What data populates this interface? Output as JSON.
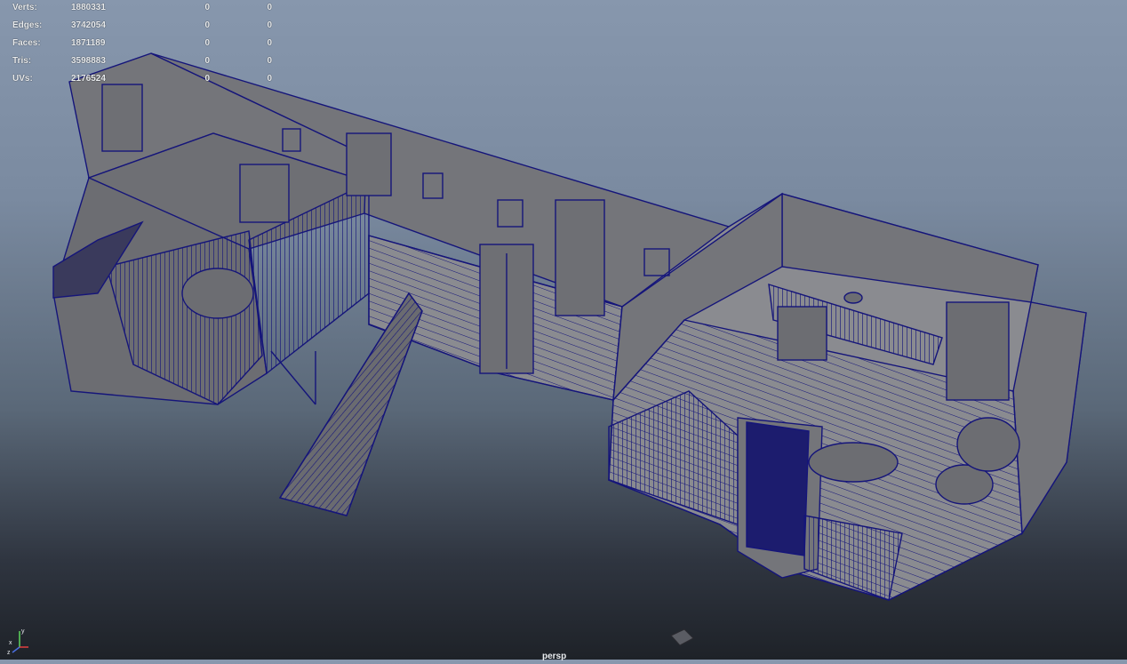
{
  "hud": {
    "rows": [
      {
        "label": "Verts:",
        "total": "1880331",
        "selected": "0",
        "component": "0"
      },
      {
        "label": "Edges:",
        "total": "3742054",
        "selected": "0",
        "component": "0"
      },
      {
        "label": "Faces:",
        "total": "1871189",
        "selected": "0",
        "component": "0"
      },
      {
        "label": "Tris:",
        "total": "3598883",
        "selected": "0",
        "component": "0"
      },
      {
        "label": "UVs:",
        "total": "2176524",
        "selected": "0",
        "component": "0"
      }
    ]
  },
  "camera": {
    "name": "persp"
  },
  "axis_gizmo": {
    "x": "x",
    "y": "y",
    "z": "z"
  },
  "colors": {
    "wire": "#15157a",
    "wall": "#74757a",
    "floor": "#8a8b90",
    "bg_top": "#8797ad",
    "bg_bottom": "#1e2228"
  }
}
